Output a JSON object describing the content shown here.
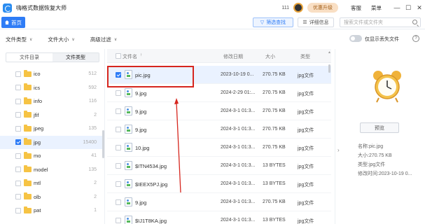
{
  "app": {
    "title": "嗨格式数据恢复大师",
    "count": "111",
    "upgrade_label": "优惠升级",
    "service_label": "客服",
    "menu_label": "菜单"
  },
  "nav": {
    "home_tab": "首页",
    "filter_btn": "筛选查找",
    "detail_btn": "详细信息",
    "search_placeholder": "搜索文件或文件夹"
  },
  "filters": {
    "file_type": "文件类型",
    "file_size": "文件大小",
    "advanced": "高级过滤",
    "toggle_label": "仅显示丢失文件"
  },
  "sidebar": {
    "tabs": [
      "文件目录",
      "文件类型"
    ],
    "active_tab": 1,
    "items": [
      {
        "name": "ico",
        "count": "512",
        "selected": false
      },
      {
        "name": "ics",
        "count": "592",
        "selected": false
      },
      {
        "name": "info",
        "count": "116",
        "selected": false
      },
      {
        "name": "jfif",
        "count": "2",
        "selected": false
      },
      {
        "name": "jpeg",
        "count": "135",
        "selected": false
      },
      {
        "name": "jpg",
        "count": "15400",
        "selected": true
      },
      {
        "name": "mo",
        "count": "41",
        "selected": false
      },
      {
        "name": "model",
        "count": "135",
        "selected": false
      },
      {
        "name": "mtl",
        "count": "2",
        "selected": false
      },
      {
        "name": "olb",
        "count": "2",
        "selected": false
      },
      {
        "name": "pat",
        "count": "1",
        "selected": false
      }
    ]
  },
  "table": {
    "columns": [
      "文件名",
      "修改日期",
      "大小",
      "类型"
    ],
    "rows": [
      {
        "name": "pic.jpg",
        "date": "2023-10-19 0...",
        "size": "270.75 KB",
        "type": "jpg文件",
        "selected": true
      },
      {
        "name": "9.jpg",
        "date": "2024-2-29 01:...",
        "size": "270.75 KB",
        "type": "jpg文件",
        "selected": false
      },
      {
        "name": "9.jpg",
        "date": "2024-3-1 01:3...",
        "size": "270.75 KB",
        "type": "jpg文件",
        "selected": false
      },
      {
        "name": "9.jpg",
        "date": "2024-3-1 01:3...",
        "size": "270.75 KB",
        "type": "jpg文件",
        "selected": false
      },
      {
        "name": "10.jpg",
        "date": "2024-3-1 01:3...",
        "size": "270.75 KB",
        "type": "jpg文件",
        "selected": false
      },
      {
        "name": "$ITN4534.jpg",
        "date": "2024-3-1 01:3...",
        "size": "13 BYTES",
        "type": "jpg文件",
        "selected": false
      },
      {
        "name": "$IEEX5PJ.jpg",
        "date": "2024-3-1 01:3...",
        "size": "13 BYTES",
        "type": "jpg文件",
        "selected": false
      },
      {
        "name": "9.jpg",
        "date": "2024-3-1 01:3...",
        "size": "270.75 KB",
        "type": "jpg文件",
        "selected": false
      },
      {
        "name": "$IJ1T8KA.jpg",
        "date": "2024-3-1 01:3...",
        "size": "13 BYTES",
        "type": "jpg文件",
        "selected": false
      }
    ]
  },
  "details": {
    "preview_btn": "预览",
    "name": "名称:pic.jpg",
    "size": "大小:270.75 KB",
    "type": "类型:jpg文件",
    "modified": "修改时间:2023-10-19 0..."
  },
  "colors": {
    "accent": "#2e7cf6",
    "annotation": "#d6261e",
    "folder": "#f6c344"
  }
}
